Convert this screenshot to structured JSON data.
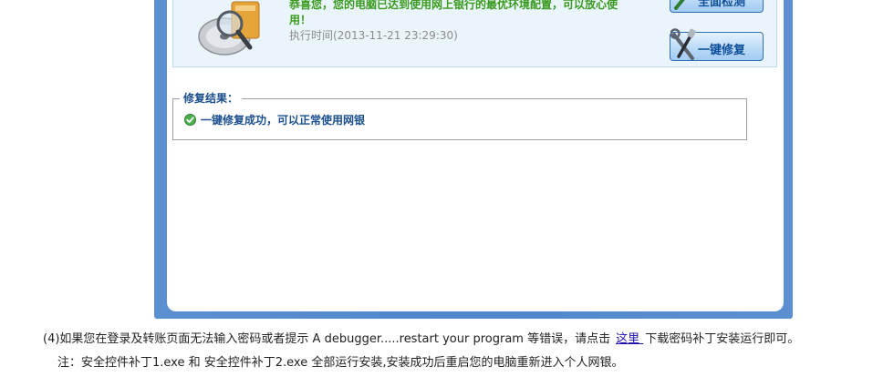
{
  "status_panel": {
    "message": "恭喜您，您的电脑已达到使用网上银行的最优环境配置，可以放心使用！",
    "exec_time": "执行时间(2013-11-21 23:29:30)"
  },
  "buttons": {
    "full_scan_label": "全面检测",
    "one_click_repair_label": "一键修复"
  },
  "repair_result": {
    "legend": "修复结果：",
    "message": "一键修复成功，可以正常使用网银"
  },
  "article": {
    "line4_before": "(4)如果您在登录及转账页面无法输入密码或者提示  A debugger.....restart your program 等错误，请点击",
    "link_text": "这里 ",
    "line4_after": "下载密码补丁安装运行即可。",
    "note": "注：安全控件补丁1.exe 和  安全控件补丁2.exe 全部运行安装,安装成功后重启您的电脑重新进入个人网银。"
  },
  "icons": {
    "hdd": "hard-drive-magnifier-icon",
    "scan": "scan-tool-icon",
    "repair": "wrench-screwdriver-icon",
    "success": "green-check-icon"
  },
  "colors": {
    "frame_blue": "#4f86cc",
    "success_green": "#3a9a1e",
    "label_blue": "#1b4f8f",
    "link_blue": "#1a0dab"
  }
}
